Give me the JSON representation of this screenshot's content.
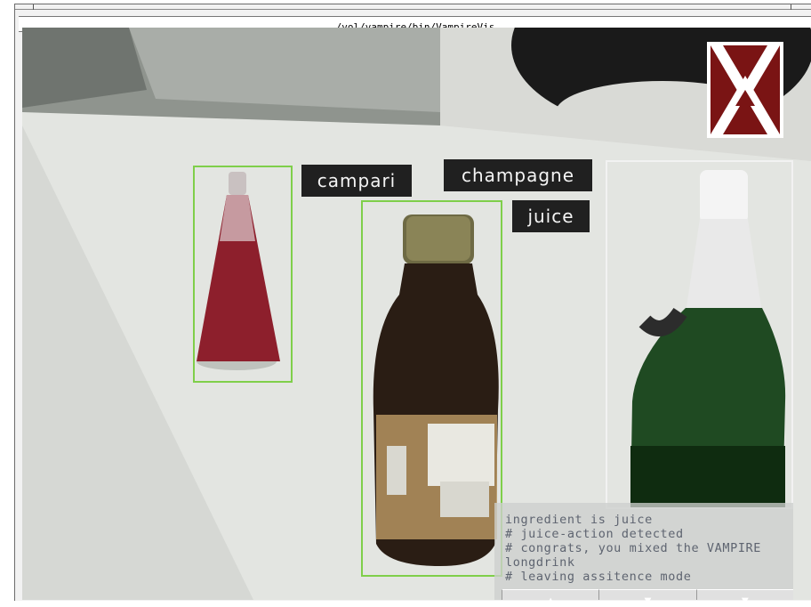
{
  "window": {
    "title": "/vol/vampire/bin/VampireVis"
  },
  "detections": [
    {
      "id": "campari",
      "label": "campari",
      "box_color": "#7fcf4a"
    },
    {
      "id": "juice",
      "label": "juice",
      "box_color": "#7fcf4a"
    },
    {
      "id": "champagne",
      "label": "champagne",
      "box_color": "#f2f2f2"
    }
  ],
  "console": {
    "lines": [
      "ingredient is juice",
      "# juice-action detected",
      "# congrats, you mixed the VAMPIRE",
      "longdrink",
      "# leaving assitence mode"
    ],
    "buttons": [
      {
        "icon": "up-arrow-icon"
      },
      {
        "icon": "down-arrow-icon"
      },
      {
        "icon": "down-arrow-icon"
      }
    ]
  },
  "logo": {
    "name": "vampire-logo",
    "colors": [
      "#7a1414",
      "#ffffff"
    ]
  },
  "colors": {
    "green_box": "#7fcf4a",
    "white_box": "#f2f2f2",
    "label_bg": "#202020"
  }
}
